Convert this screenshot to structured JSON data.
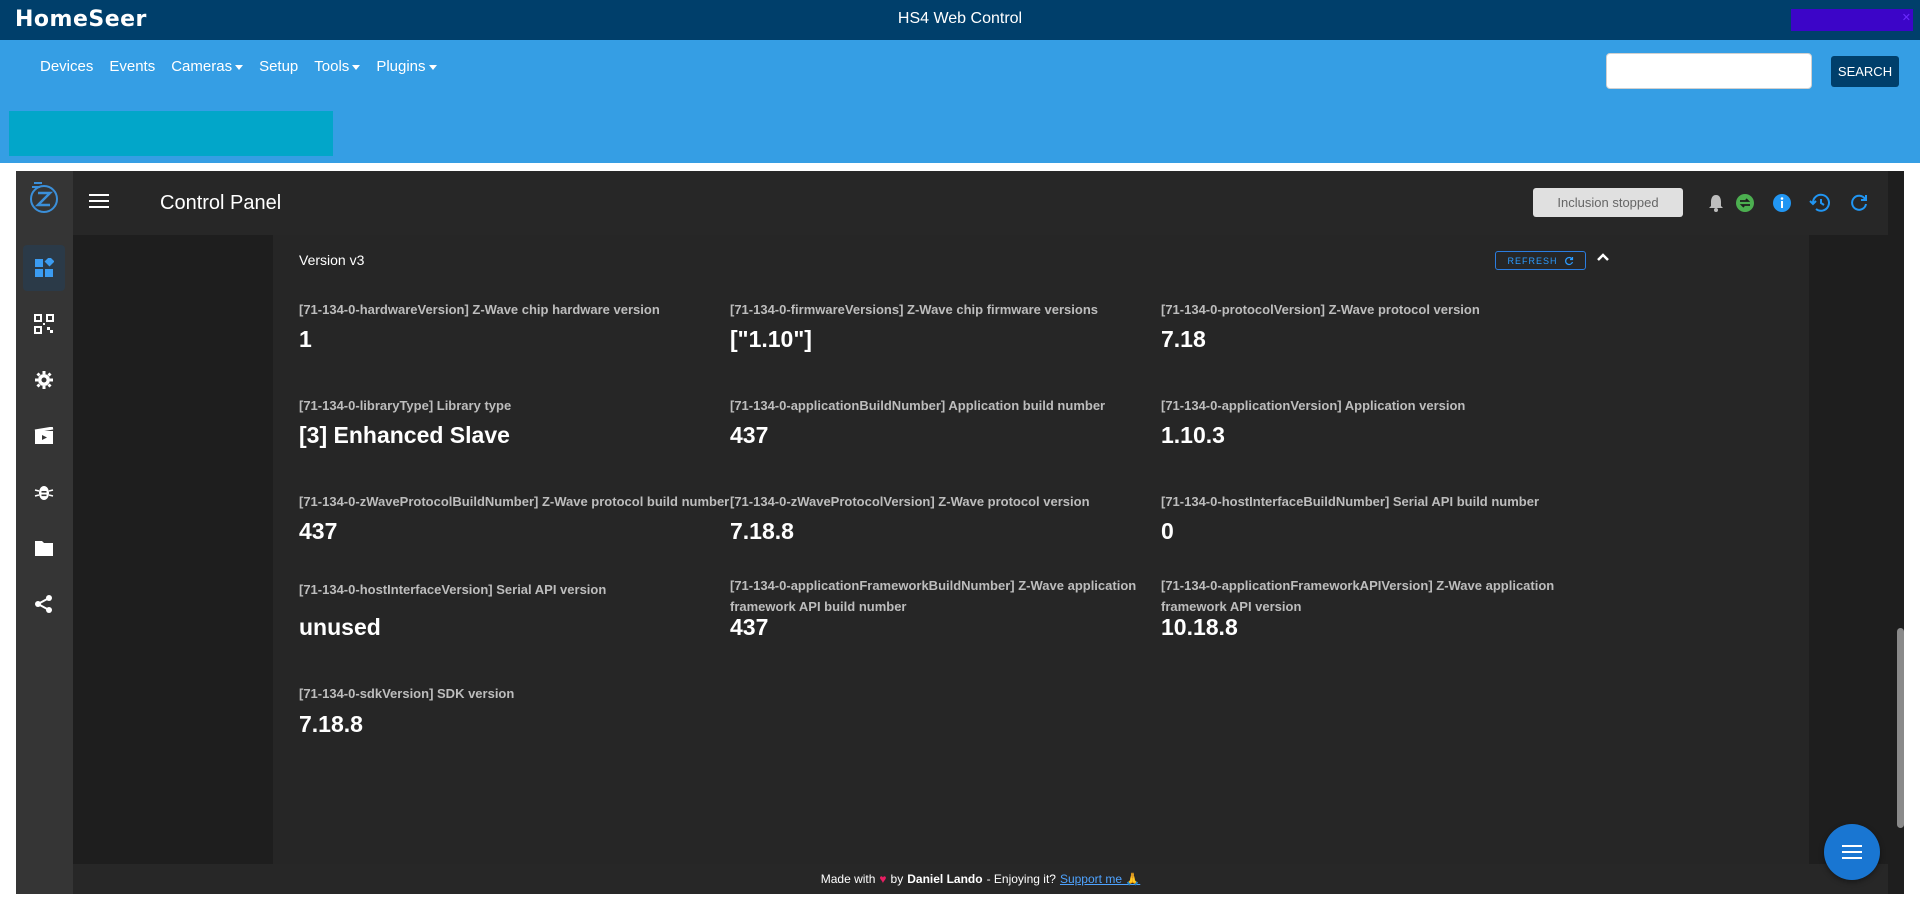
{
  "app": {
    "logo": "HomeSeer",
    "title": "HS4 Web Control"
  },
  "nav": {
    "items": [
      {
        "label": "Devices",
        "dropdown": false
      },
      {
        "label": "Events",
        "dropdown": false
      },
      {
        "label": "Cameras",
        "dropdown": true
      },
      {
        "label": "Setup",
        "dropdown": false
      },
      {
        "label": "Tools",
        "dropdown": true
      },
      {
        "label": "Plugins",
        "dropdown": true
      }
    ],
    "search": {
      "placeholder": "",
      "button_label": "SEARCH"
    }
  },
  "sidebar": {
    "icons": [
      "dashboard-icon",
      "qr-scan-icon",
      "settings-icon",
      "scenes-icon",
      "debug-icon",
      "folder-icon",
      "share-icon"
    ]
  },
  "header": {
    "title": "Control Panel",
    "inclusion_status": "Inclusion stopped",
    "icons": [
      "bell-icon",
      "swap-icon",
      "info-icon",
      "history-icon",
      "refresh-icon"
    ],
    "colors": {
      "swap": "#4caf50",
      "info": "#2196f3",
      "history": "#2196f3",
      "refresh": "#2196f3"
    }
  },
  "section": {
    "title": "Version v3",
    "refresh_label": "REFRESH",
    "fields": [
      {
        "label": "[71-134-0-hardwareVersion] Z-Wave chip hardware version",
        "value": "1"
      },
      {
        "label": "[71-134-0-firmwareVersions] Z-Wave chip firmware versions",
        "value": "[\"1.10\"]"
      },
      {
        "label": "[71-134-0-protocolVersion] Z-Wave protocol version",
        "value": "7.18"
      },
      {
        "label": "[71-134-0-libraryType] Library type",
        "value": "[3] Enhanced Slave"
      },
      {
        "label": "[71-134-0-applicationBuildNumber] Application build number",
        "value": "437"
      },
      {
        "label": "[71-134-0-applicationVersion] Application version",
        "value": "1.10.3"
      },
      {
        "label": "[71-134-0-zWaveProtocolBuildNumber] Z-Wave protocol build number",
        "value": "437"
      },
      {
        "label": "[71-134-0-zWaveProtocolVersion] Z-Wave protocol version",
        "value": "7.18.8"
      },
      {
        "label": "[71-134-0-hostInterfaceBuildNumber] Serial API build number",
        "value": "0"
      },
      {
        "label": "[71-134-0-hostInterfaceVersion] Serial API version",
        "value": "unused"
      },
      {
        "label": "[71-134-0-applicationFrameworkBuildNumber] Z-Wave application framework API build number",
        "value": "437"
      },
      {
        "label": "[71-134-0-applicationFrameworkAPIVersion] Z-Wave application framework API version",
        "value": "10.18.8"
      },
      {
        "label": "[71-134-0-sdkVersion] SDK version",
        "value": "7.18.8"
      }
    ]
  },
  "footer": {
    "made_with": "Made with",
    "by": "by",
    "author": "Daniel Lando",
    "enjoying": "- Enjoying it?",
    "support": "Support me 🙏"
  }
}
